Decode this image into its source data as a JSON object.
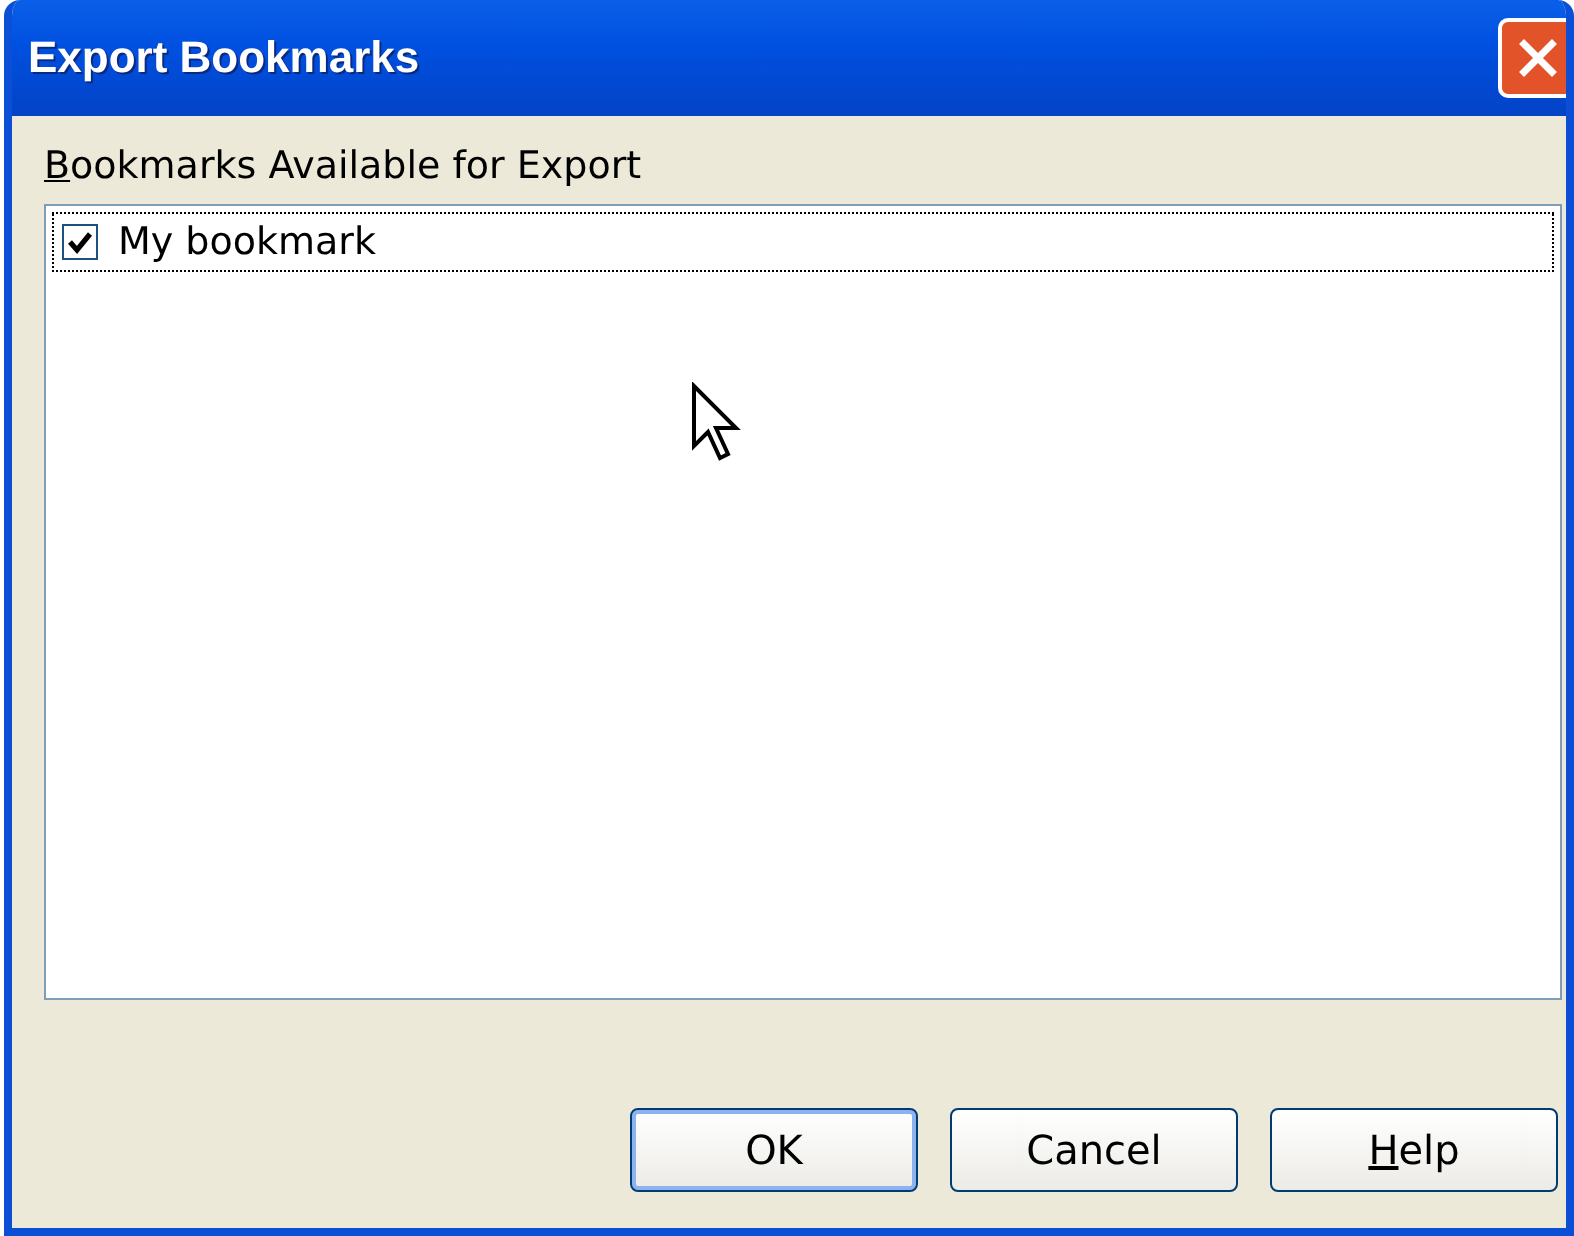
{
  "window": {
    "title": "Export Bookmarks"
  },
  "list": {
    "label": "Bookmarks Available for Export",
    "first_letter_underlined": true,
    "items": [
      {
        "label": "My bookmark",
        "checked": true,
        "focused": true
      }
    ]
  },
  "buttons": [
    {
      "label": "OK",
      "default": true,
      "first_letter_underlined": false
    },
    {
      "label": "Cancel",
      "default": false,
      "first_letter_underlined": false
    },
    {
      "label": "Help",
      "default": false,
      "first_letter_underlined": true
    }
  ]
}
